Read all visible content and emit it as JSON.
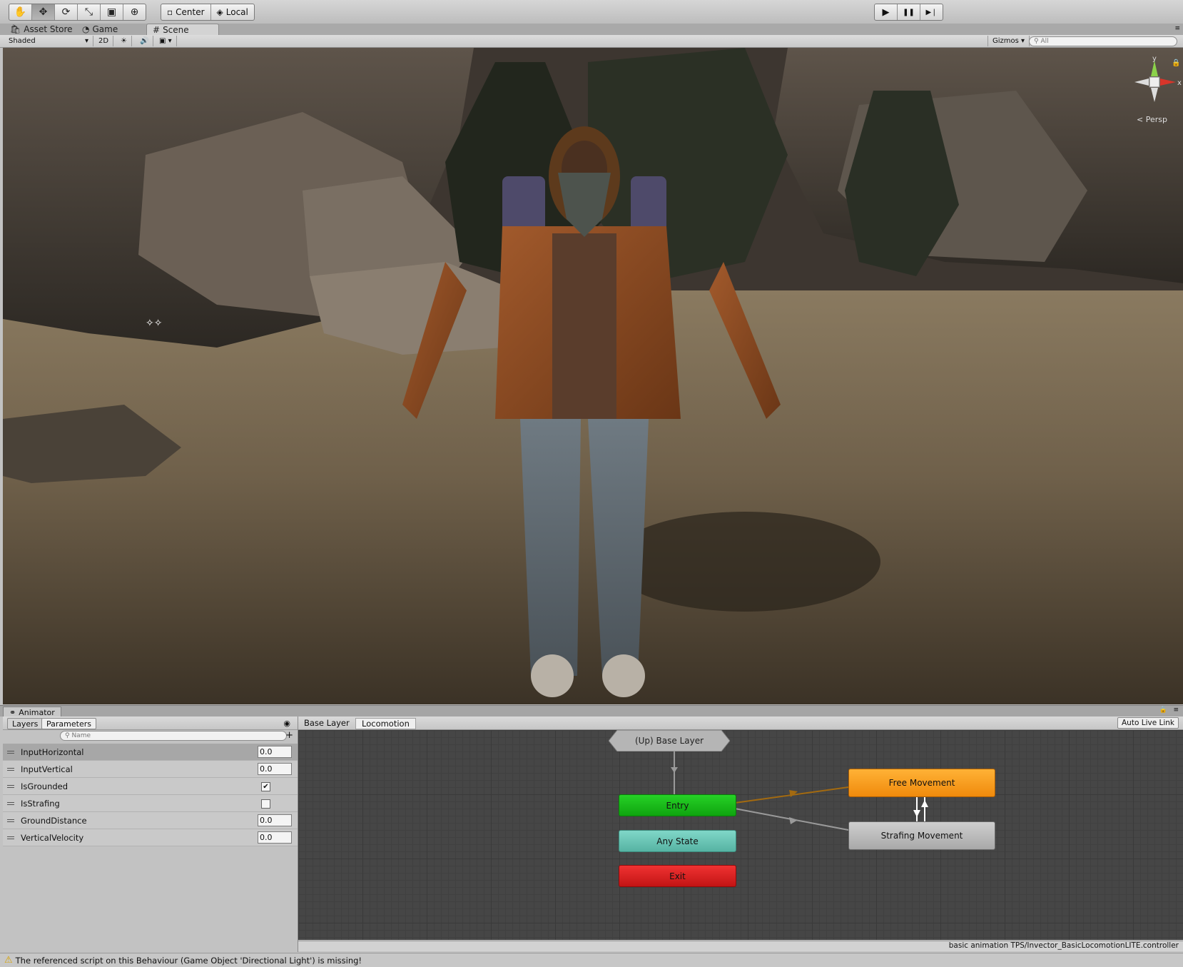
{
  "toolbar": {
    "tools": [
      {
        "name": "hand-tool",
        "glyph": "✋"
      },
      {
        "name": "move-tool",
        "glyph": "✥"
      },
      {
        "name": "rotate-tool",
        "glyph": "⟳"
      },
      {
        "name": "scale-tool",
        "glyph": "⤡"
      },
      {
        "name": "rect-tool",
        "glyph": "▣"
      },
      {
        "name": "transform-tool",
        "glyph": "⊕"
      }
    ],
    "center_label": "Center",
    "local_label": "Local",
    "play_icon": "▶",
    "pause_icon": "❚❚",
    "step_icon": "▶❘"
  },
  "tabs": {
    "asset_store": "Asset Store",
    "game": "Game",
    "scene": "Scene"
  },
  "scene_toolbar": {
    "shading_mode": "Shaded",
    "mode_2d": "2D",
    "gizmos_label": "Gizmos",
    "search_placeholder": "All"
  },
  "scene": {
    "projection_label": "< Persp",
    "axis_y": "y",
    "axis_x": "x"
  },
  "animator": {
    "tab_title": "Animator",
    "layers_tab": "Layers",
    "parameters_tab": "Parameters",
    "name_search_placeholder": "Name",
    "parameters": [
      {
        "name": "InputHorizontal",
        "type": "float",
        "value": "0.0"
      },
      {
        "name": "InputVertical",
        "type": "float",
        "value": "0.0"
      },
      {
        "name": "IsGrounded",
        "type": "bool",
        "value": "✔"
      },
      {
        "name": "IsStrafing",
        "type": "bool",
        "value": ""
      },
      {
        "name": "GroundDistance",
        "type": "float",
        "value": "0.0"
      },
      {
        "name": "VerticalVelocity",
        "type": "float",
        "value": "0.0"
      }
    ],
    "breadcrumb": [
      "Base Layer",
      "Locomotion"
    ],
    "auto_live_link": "Auto Live Link",
    "nodes": {
      "up": "(Up) Base Layer",
      "entry": "Entry",
      "any_state": "Any State",
      "exit": "Exit",
      "free_movement": "Free Movement",
      "strafing_movement": "Strafing Movement"
    },
    "controller_path": "basic animation TPS/Invector_BasicLocomotionLITE.controller"
  },
  "status": {
    "message": "The referenced script on this Behaviour (Game Object 'Directional Light') is missing!"
  },
  "colors": {
    "entry": "#16b616",
    "any_state": "#62c0b0",
    "exit": "#d81c1c",
    "free_movement": "#f59a1e",
    "strafing": "#b8b8b8"
  }
}
